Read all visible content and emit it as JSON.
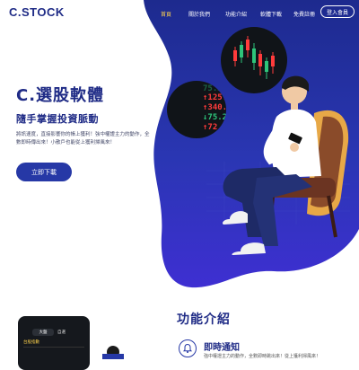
{
  "header": {
    "logo": "C.STOCK",
    "nav": [
      {
        "label": "首頁",
        "active": true
      },
      {
        "label": "關於我們",
        "active": false
      },
      {
        "label": "功能介紹",
        "active": false
      },
      {
        "label": "軟體下載",
        "active": false
      },
      {
        "label": "免費註冊",
        "active": false
      }
    ],
    "login": "登入會員"
  },
  "hero": {
    "title": "C.選股軟體",
    "subtitle": "隨手掌握投資脈動",
    "description": "將訊速度，直接影響你的帳上獲利！強中權證主力的動作，全數即時傳出來！小散戶也能從上獲利掃風來！",
    "cta": "立即下載"
  },
  "ticker": {
    "prices": [
      {
        "value": "↑125.5",
        "dir": "up"
      },
      {
        "value": "↑340.5",
        "dir": "up"
      },
      {
        "value": "↓75.25",
        "dir": "down"
      },
      {
        "value": "↑72.5",
        "dir": "up"
      }
    ],
    "faded_top": "75.25"
  },
  "features": {
    "title": "功能介紹",
    "items": [
      {
        "name": "即時通知",
        "icon": "bell-icon",
        "desc": "強中權證主力的動作，全數即時跳出來！從上獲利掃風來！"
      }
    ]
  },
  "phone": {
    "tabs": [
      "大盤",
      "自選"
    ],
    "row": "台股指數"
  },
  "colors": {
    "brand": "#1f2b86",
    "accent_blue": "#2638a6",
    "nav_active": "#ffd34d",
    "blob_top": "#2b39b0",
    "blob_bottom": "#3c2fd0"
  }
}
